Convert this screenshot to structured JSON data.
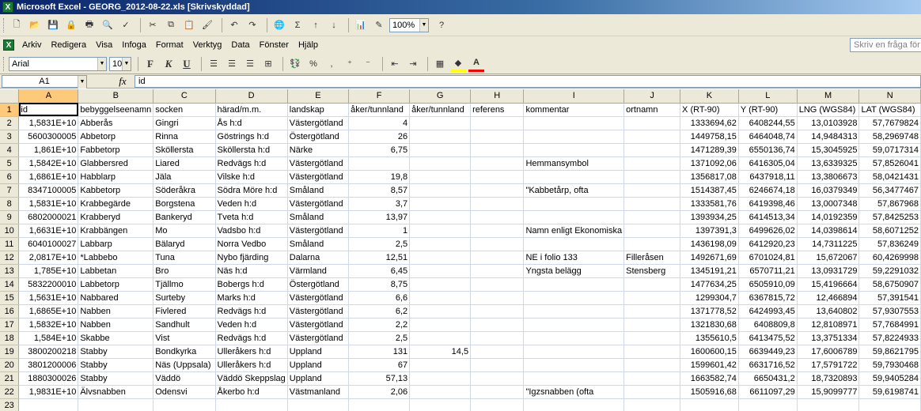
{
  "window": {
    "title": "Microsoft Excel - GEORG_2012-08-22.xls  [Skrivskyddad]"
  },
  "toolbar": {
    "zoom": "100%"
  },
  "menu": [
    "Arkiv",
    "Redigera",
    "Visa",
    "Infoga",
    "Format",
    "Verktyg",
    "Data",
    "Fönster",
    "Hjälp"
  ],
  "help_placeholder": "Skriv en fråga för hjälp",
  "format_bar": {
    "font": "Arial",
    "size": "10"
  },
  "formula_bar": {
    "cell": "A1",
    "value": "id"
  },
  "columns": [
    "A",
    "B",
    "C",
    "D",
    "E",
    "F",
    "G",
    "H",
    "I",
    "J",
    "K",
    "L",
    "M",
    "N"
  ],
  "rows": [
    [
      "id",
      "bebyggelseenamn",
      "socken",
      "härad/m.m.",
      "landskap",
      "åker/tunnland",
      "åker/tunnland",
      "referens",
      "kommentar",
      "ortnamn",
      "X (RT-90)",
      "Y (RT-90)",
      "LNG (WGS84)",
      "LAT (WGS84)"
    ],
    [
      "1,5831E+10",
      "Abberås",
      "Gingri",
      "Ås h:d",
      "Västergötland",
      "4",
      "",
      "",
      "",
      "",
      "1333694,62",
      "6408244,55",
      "13,0103928",
      "57,7679824"
    ],
    [
      "5600300005",
      "Abbetorp",
      "Rinna",
      "Göstrings h:d",
      "Östergötland",
      "26",
      "",
      "",
      "",
      "",
      "1449758,15",
      "6464048,74",
      "14,9484313",
      "58,2969748"
    ],
    [
      "1,861E+10",
      "Fabbetorp",
      "Sköllersta",
      "Sköllersta h:d",
      "Närke",
      "6,75",
      "",
      "",
      "",
      "",
      "1471289,39",
      "6550136,74",
      "15,3045925",
      "59,0717314"
    ],
    [
      "1,5842E+10",
      "Glabbersred",
      "Liared",
      "Redvägs h:d",
      "Västergötland",
      "",
      "",
      "",
      "Hemmansymbol",
      "",
      "1371092,06",
      "6416305,04",
      "13,6339325",
      "57,8526041"
    ],
    [
      "1,6861E+10",
      "Habblarp",
      "Jäla",
      "Vilske h:d",
      "Västergötland",
      "19,8",
      "",
      "",
      "",
      "",
      "1356817,08",
      "6437918,11",
      "13,3806673",
      "58,0421431"
    ],
    [
      "8347100005",
      "Kabbetorp",
      "Söderåkra",
      "Södra Möre h:d",
      "Småland",
      "8,57",
      "",
      "",
      "\"Kabbetårp, ofta",
      "",
      "1514387,45",
      "6246674,18",
      "16,0379349",
      "56,3477467"
    ],
    [
      "1,5831E+10",
      "Krabbegärde",
      "Borgstena",
      "Veden h:d",
      "Västergötland",
      "3,7",
      "",
      "",
      "",
      "",
      "1333581,76",
      "6419398,46",
      "13,0007348",
      "57,867968"
    ],
    [
      "6802000021",
      "Krabberyd",
      "Bankeryd",
      "Tveta h:d",
      "Småland",
      "13,97",
      "",
      "",
      "",
      "",
      "1393934,25",
      "6414513,34",
      "14,0192359",
      "57,8425253"
    ],
    [
      "1,6631E+10",
      "Krabbängen",
      "Mo",
      "Vadsbo h:d",
      "Västergötland",
      "1",
      "",
      "",
      "Namn enligt Ekonomiska",
      "",
      "1397391,3",
      "6499626,02",
      "14,0398614",
      "58,6071252"
    ],
    [
      "6040100027",
      "Labbarp",
      "Bälaryd",
      "Norra Vedbo",
      "Småland",
      "2,5",
      "",
      "",
      "",
      "",
      "1436198,09",
      "6412920,23",
      "14,7311225",
      "57,836249"
    ],
    [
      "2,0817E+10",
      "*Labbebo",
      "Tuna",
      "Nybo fjärding",
      "Dalarna",
      "12,51",
      "",
      "",
      "NE i folio 133",
      "Filleråsen",
      "1492671,69",
      "6701024,81",
      "15,672067",
      "60,4269998"
    ],
    [
      "1,785E+10",
      "Labbetan",
      "Bro",
      "Näs h:d",
      "Värmland",
      "6,45",
      "",
      "",
      "Yngsta belägg",
      "Stensberg",
      "1345191,21",
      "6570711,21",
      "13,0931729",
      "59,2291032"
    ],
    [
      "5832200010",
      "Labbetorp",
      "Tjällmo",
      "Bobergs h:d",
      "Östergötland",
      "8,75",
      "",
      "",
      "",
      "",
      "1477634,25",
      "6505910,09",
      "15,4196664",
      "58,6750907"
    ],
    [
      "1,5631E+10",
      "Nabbared",
      "Surteby",
      "Marks h:d",
      "Västergötland",
      "6,6",
      "",
      "",
      "",
      "",
      "1299304,7",
      "6367815,72",
      "12,466894",
      "57,391541"
    ],
    [
      "1,6865E+10",
      "Nabben",
      "Fivlered",
      "Redvägs h:d",
      "Västergötland",
      "6,2",
      "",
      "",
      "",
      "",
      "1371778,52",
      "6424993,45",
      "13,640802",
      "57,9307553"
    ],
    [
      "1,5832E+10",
      "Nabben",
      "Sandhult",
      "Veden h:d",
      "Västergötland",
      "2,2",
      "",
      "",
      "",
      "",
      "1321830,68",
      "6408809,8",
      "12,8108971",
      "57,7684991"
    ],
    [
      "1,584E+10",
      "Skabbe",
      "Vist",
      "Redvägs h:d",
      "Västergötland",
      "2,5",
      "",
      "",
      "",
      "",
      "1355610,5",
      "6413475,52",
      "13,3751334",
      "57,8224933"
    ],
    [
      "3800200218",
      "Stabby",
      "Bondkyrka",
      "Ulleråkers h:d",
      "Uppland",
      "131",
      "14,5",
      "",
      "",
      "",
      "1600600,15",
      "6639449,23",
      "17,6006789",
      "59,8621795"
    ],
    [
      "3801200006",
      "Stabby",
      "Näs (Uppsala)",
      "Ulleråkers h:d",
      "Uppland",
      "67",
      "",
      "",
      "",
      "",
      "1599601,42",
      "6631716,52",
      "17,5791722",
      "59,7930468"
    ],
    [
      "1880300026",
      "Stabby",
      "Väddö",
      "Väddö Skeppslag",
      "Uppland",
      "57,13",
      "",
      "",
      "",
      "",
      "1663582,74",
      "6650431,2",
      "18,7320893",
      "59,9405284"
    ],
    [
      "1,9831E+10",
      "Älvsnabben",
      "Odensvi",
      "Åkerbo h:d",
      "Västmanland",
      "2,06",
      "",
      "",
      "\"Igzsnabben (ofta",
      "",
      "1505916,68",
      "6611097,29",
      "15,9099777",
      "59,6198741"
    ],
    [
      "",
      "",
      "",
      "",
      "",
      "",
      "",
      "",
      "",
      "",
      "",
      "",
      "",
      ""
    ]
  ]
}
